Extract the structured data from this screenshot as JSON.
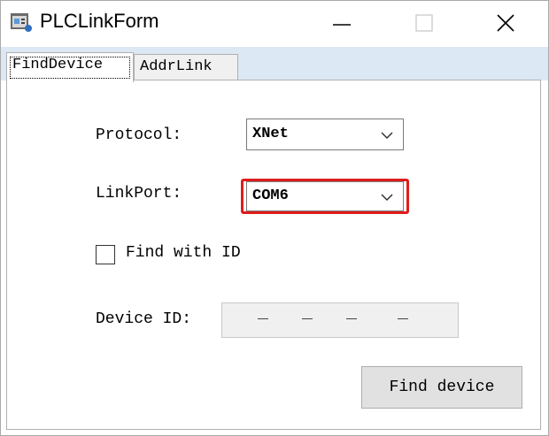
{
  "window": {
    "title": "PLCLinkForm"
  },
  "icons": {
    "app": "app-icon",
    "minimize": "minimize-icon",
    "maximize": "maximize-icon",
    "close": "close-icon",
    "dropdown": "chevron-down-icon"
  },
  "tabs": [
    {
      "label": "FindDevice",
      "selected": true
    },
    {
      "label": "AddrLink",
      "selected": false
    }
  ],
  "find_device": {
    "protocol_label": "Protocol:",
    "protocol_value": "XNet",
    "linkport_label": "LinkPort:",
    "linkport_value": "COM6",
    "find_with_id_label": "Find with ID",
    "find_with_id_checked": false,
    "device_id_label": "Device ID:",
    "device_id_value": "- - - -",
    "find_button_label": "Find device"
  },
  "colors": {
    "highlight": "#e01c1c",
    "tabstrip": "#dce8f4"
  }
}
